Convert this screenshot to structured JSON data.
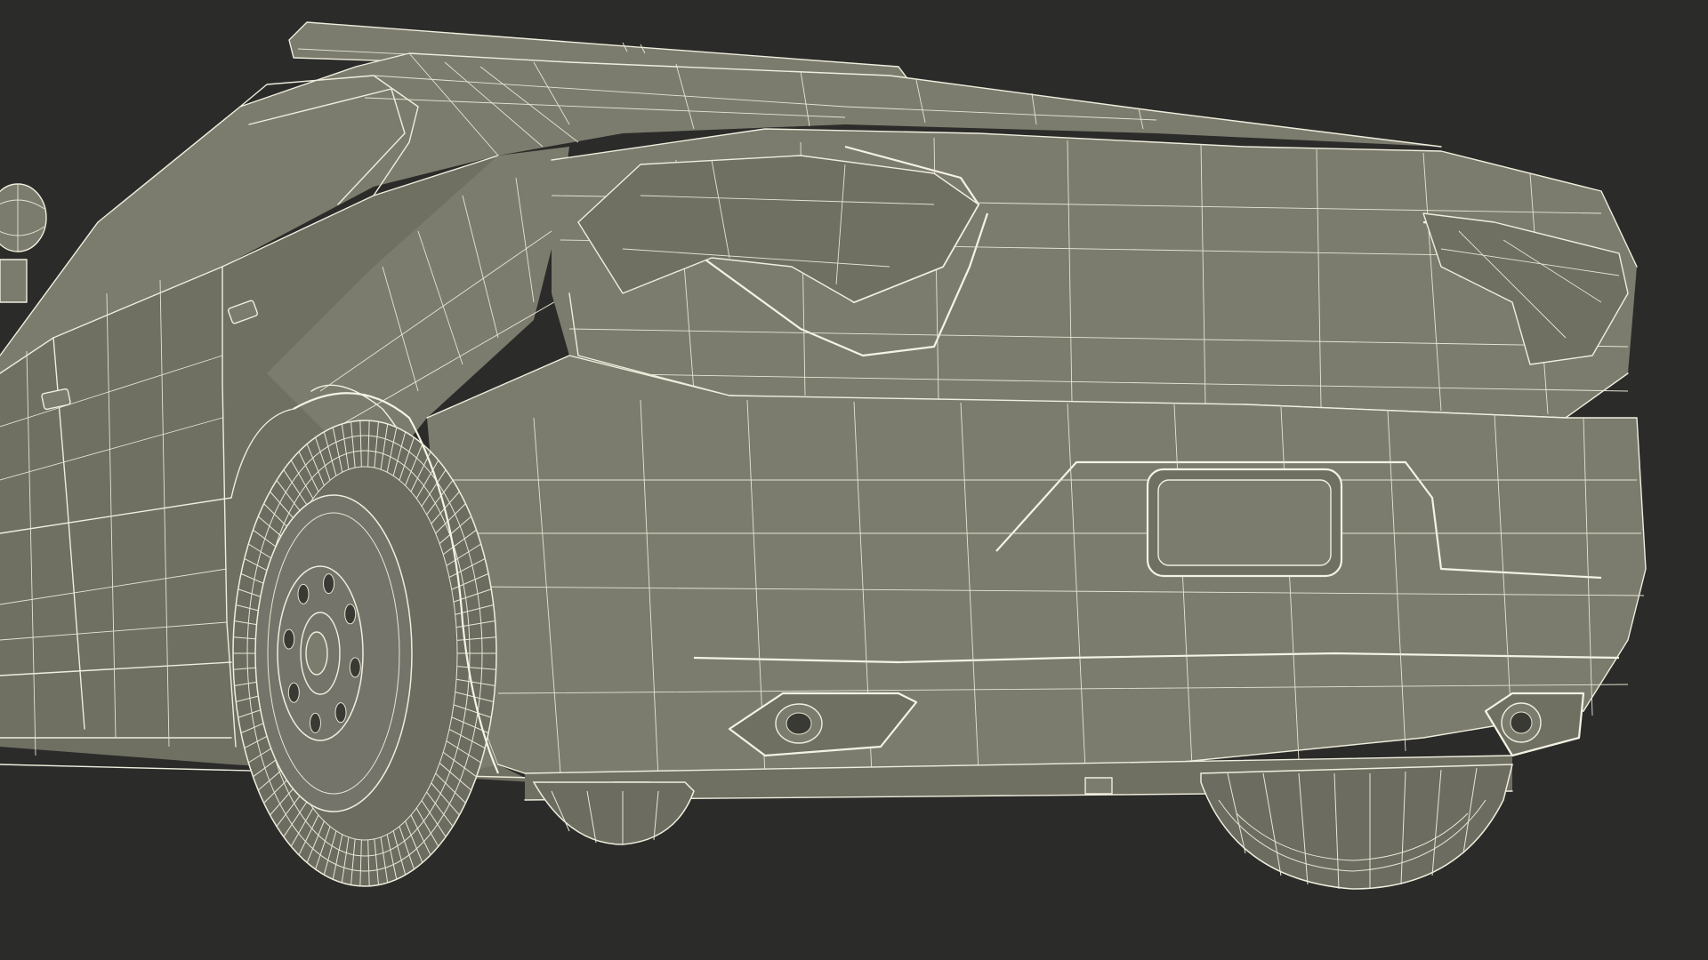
{
  "scene": {
    "subject": "wireframe-car-rear",
    "colors": {
      "background": "#2b2b2a",
      "surface": "#7c7c6e",
      "surface_dark": "#6f6f62",
      "wire": "#efeedd",
      "tire": "#6c6c60"
    }
  }
}
